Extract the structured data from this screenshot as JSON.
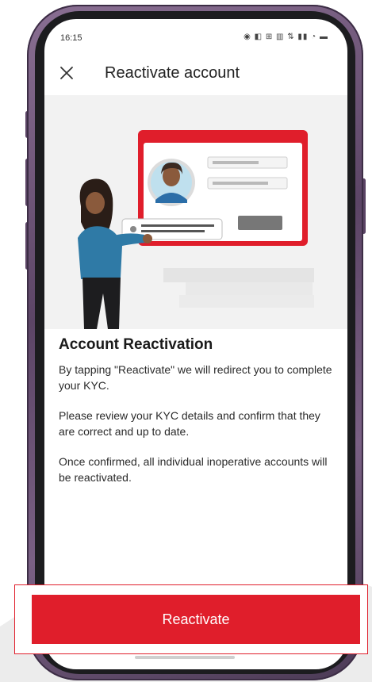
{
  "status_bar": {
    "time": "16:15",
    "icons": "◉ ◧ ⊞ ▥ ⇅ ▮▮ ◔ ▬"
  },
  "header": {
    "close_icon": "close-icon",
    "title": "Reactivate account"
  },
  "illustration": {
    "description_icon": "kyc-illustration"
  },
  "content": {
    "title": "Account Reactivation",
    "para1": "By tapping \"Reactivate\" we will redirect you to complete your KYC.",
    "para2": "Please review your KYC details and confirm that they are correct and up to date.",
    "para3": "Once confirmed, all individual inoperative accounts will be reactivated."
  },
  "cta": {
    "label": "Reactivate"
  },
  "colors": {
    "accent": "#e01e2b",
    "phone_frame": "#6b5275",
    "illustration_bg": "#f2f2f2"
  }
}
